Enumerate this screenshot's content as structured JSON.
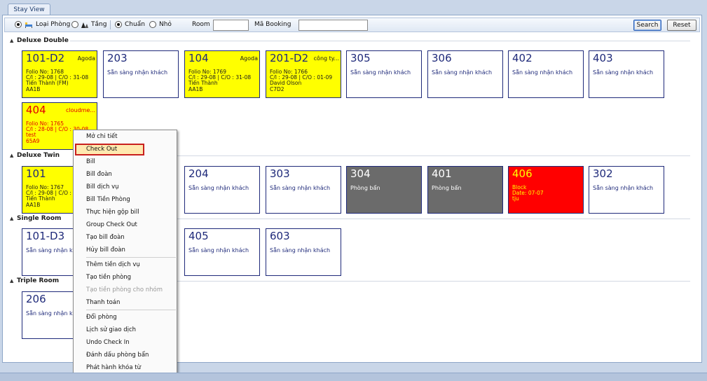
{
  "tab": {
    "label": "Stay View"
  },
  "toolbar": {
    "view_room_type": "Loại Phòng",
    "view_floor": "Tầng",
    "size_standard": "Chuẩn",
    "size_small": "Nhỏ",
    "room_label": "Room",
    "room_value": "",
    "booking_label": "Mã Booking",
    "booking_value": "",
    "search_label": "Search",
    "reset_label": "Reset"
  },
  "groups": {
    "deluxe_double": {
      "title": "Deluxe Double",
      "rooms": [
        {
          "number": "101-D2",
          "source": "Agoda",
          "lines": [
            "Folio No: 1768",
            "C/I : 29-08 | C/O : 31-08",
            "Tiến Thành (FM)",
            "AA1B"
          ]
        },
        {
          "number": "203",
          "status": "Sẵn sàng nhận khách"
        },
        {
          "number": "104",
          "source": "Agoda",
          "lines": [
            "Folio No: 1769",
            "C/I : 29-08 | C/O : 31-08",
            "Tiến Thành",
            "AA1B"
          ]
        },
        {
          "number": "201-D2",
          "source": "công ty...",
          "lines": [
            "Folio No: 1766",
            "C/I : 29-08 | C/O : 01-09",
            "David Olson",
            "C7D2"
          ]
        },
        {
          "number": "305",
          "status": "Sẵn sàng nhận khách"
        },
        {
          "number": "306",
          "status": "Sẵn sàng nhận khách"
        },
        {
          "number": "402",
          "status": "Sẵn sàng nhận khách"
        },
        {
          "number": "403",
          "status": "Sẵn sàng nhận khách"
        },
        {
          "number": "404",
          "source": "cloudme...",
          "lines": [
            "Folio No: 1765",
            "C/I : 28-08 | C/O : 30-08",
            "test",
            "65A9"
          ]
        }
      ]
    },
    "deluxe_twin": {
      "title": "Deluxe Twin",
      "rooms": [
        {
          "number": "101",
          "lines": [
            "Folio No: 1767",
            "C/I : 29-08 | C/O : 31-08",
            "Tiến Thành",
            "AA1B"
          ]
        },
        {
          "number": "204",
          "status": "Sẵn sàng nhận khách"
        },
        {
          "number": "303",
          "status": "Sẵn sàng nhận khách"
        },
        {
          "number": "304",
          "status": "Phòng bẩn"
        },
        {
          "number": "401",
          "status": "Phòng bẩn"
        },
        {
          "number": "406",
          "lines": [
            "Block",
            "Date: 07-07",
            "tju"
          ]
        },
        {
          "number": "302",
          "status": "Sẵn sàng nhận khách"
        }
      ]
    },
    "single_room": {
      "title": "Single Room",
      "rooms": [
        {
          "number": "101-D3",
          "status": "Sẵn sàng nhận khách"
        },
        {
          "number": "405",
          "status": "Sẵn sàng nhận khách"
        },
        {
          "number": "603",
          "status": "Sẵn sàng nhận khách"
        }
      ]
    },
    "triple_room": {
      "title": "Triple Room",
      "rooms": [
        {
          "number": "206",
          "status": "Sẵn sàng nhận khách"
        }
      ]
    }
  },
  "context_menu": {
    "items": [
      {
        "label": "Mở chi tiết"
      },
      {
        "label": "Check Out",
        "highlighted": true
      },
      {
        "label": "Bill"
      },
      {
        "label": "Bill đoàn"
      },
      {
        "label": "Bill dịch vụ"
      },
      {
        "label": "Bill Tiền Phòng"
      },
      {
        "label": "Thực hiện gộp bill"
      },
      {
        "label": "Group Check Out"
      },
      {
        "label": "Tạo bill đoàn"
      },
      {
        "label": "Hủy bill đoàn"
      },
      {
        "label": "Thêm tiền dịch vụ"
      },
      {
        "label": "Tạo tiền phòng"
      },
      {
        "label": "Tạo tiền phòng cho nhóm",
        "disabled": true
      },
      {
        "label": "Thanh toán"
      },
      {
        "label": "Đổi phòng"
      },
      {
        "label": "Lịch sử giao dịch"
      },
      {
        "label": "Undo Check In"
      },
      {
        "label": "Đánh dấu phòng bẩn"
      },
      {
        "label": "Phát hành khóa từ"
      }
    ]
  },
  "colors": {
    "occupied": "#ffff00",
    "dirty": "#6b6b6b",
    "blocked": "#ff0000",
    "available": "#ffffff",
    "room_text": "#1f2a7a",
    "highlight_border": "#c8201e"
  }
}
